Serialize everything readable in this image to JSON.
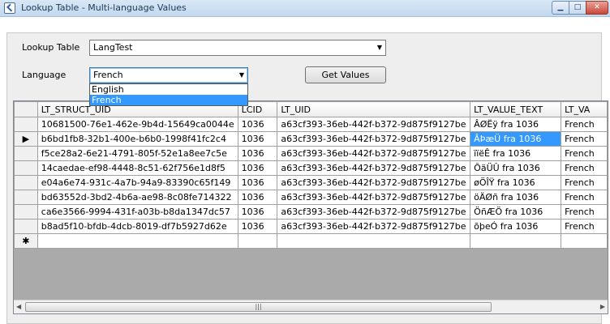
{
  "window": {
    "title": "Lookup Table - Multi-language Values",
    "min_glyph": "▁",
    "max_glyph": "□",
    "close_glyph": "✕"
  },
  "form": {
    "lookup_table_label": "Lookup Table",
    "lookup_table_value": "LangTest",
    "language_label": "Language",
    "language_value": "French",
    "language_options": [
      "English",
      "French"
    ],
    "get_values_label": "Get Values"
  },
  "grid": {
    "columns": [
      "LT_STRUCT_UID",
      "LCID",
      "LT_UID",
      "LT_VALUE_TEXT",
      "LT_VA"
    ],
    "current_row_marker": "▶",
    "new_row_marker": "✱",
    "rows": [
      [
        "10681500-76e1-462e-9b4d-15649ca0044e",
        "1036",
        "a63cf393-36eb-442f-b372-9d875f9127be",
        "ÂØËÿ  fra  1036",
        "French"
      ],
      [
        "b6bd1fb8-32b1-400e-b6b0-1998f41fc2c4",
        "1036",
        "a63cf393-36eb-442f-b372-9d875f9127be",
        "ÂÞæÜ  fra  1036",
        "French"
      ],
      [
        "f5ce28a2-6e21-4791-805f-52e1a8ee7c5e",
        "1036",
        "a63cf393-36eb-442f-b372-9d875f9127be",
        "ïïëÊ  fra  1036",
        "French"
      ],
      [
        "14caedae-ef98-4448-8c51-62f756e1d8f5",
        "1036",
        "a63cf393-36eb-442f-b372-9d875f9127be",
        "ÔäÜÛ  fra  1036",
        "French"
      ],
      [
        "e04a6e74-931c-4a7b-94a9-83390c65f149",
        "1036",
        "a63cf393-36eb-442f-b372-9d875f9127be",
        "øÖÎŸ  fra  1036",
        "French"
      ],
      [
        "bd63552d-3bd2-4b6a-ae98-8c08fe714322",
        "1036",
        "a63cf393-36eb-442f-b372-9d875f9127be",
        "öÄØñ  fra  1036",
        "French"
      ],
      [
        "ca6e3566-9994-431f-a03b-b8da1347dc57",
        "1036",
        "a63cf393-36eb-442f-b372-9d875f9127be",
        "ÖñÆÖ  fra  1036",
        "French"
      ],
      [
        "b8ad5f10-bfdb-4dcb-8019-df7b5927d62e",
        "1036",
        "a63cf393-36eb-442f-b372-9d875f9127be",
        "õþeÓ  fra  1036",
        "French"
      ]
    ],
    "scroll_left": "◀",
    "scroll_right": "▶",
    "scroll_grip": "|||"
  },
  "colors": {
    "selection": "#3399ff",
    "grid_background": "#aaaaaa"
  }
}
